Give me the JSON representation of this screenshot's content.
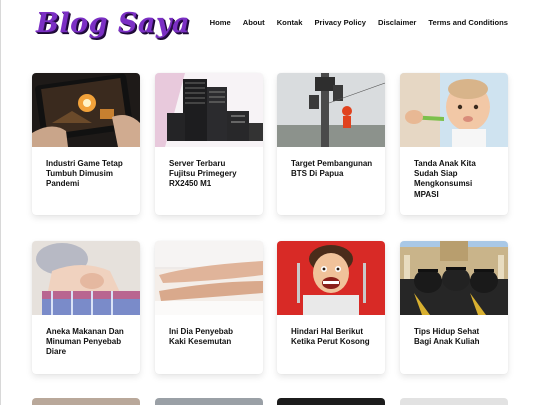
{
  "site": {
    "logo": "Blog Saya"
  },
  "nav": {
    "items": [
      {
        "label": "Home"
      },
      {
        "label": "About"
      },
      {
        "label": "Kontak"
      },
      {
        "label": "Privacy Policy"
      },
      {
        "label": "Disclaimer"
      },
      {
        "label": "Terms and Conditions"
      }
    ]
  },
  "posts": [
    {
      "title": "Industri Game Tetap Tumbuh Dimusim Pandemi"
    },
    {
      "title": "Server Terbaru Fujitsu Primegery RX2450 M1"
    },
    {
      "title": "Target Pembangunan BTS Di Papua"
    },
    {
      "title": "Tanda Anak Kita Sudah Siap Mengkonsumsi MPASI"
    },
    {
      "title": "Aneka Makanan Dan Minuman Penyebab Diare"
    },
    {
      "title": "Ini Dia Penyebab Kaki Kesemutan"
    },
    {
      "title": "Hindari Hal Berikut Ketika Perut Kosong"
    },
    {
      "title": "Tips Hidup Sehat Bagi Anak Kuliah"
    }
  ]
}
